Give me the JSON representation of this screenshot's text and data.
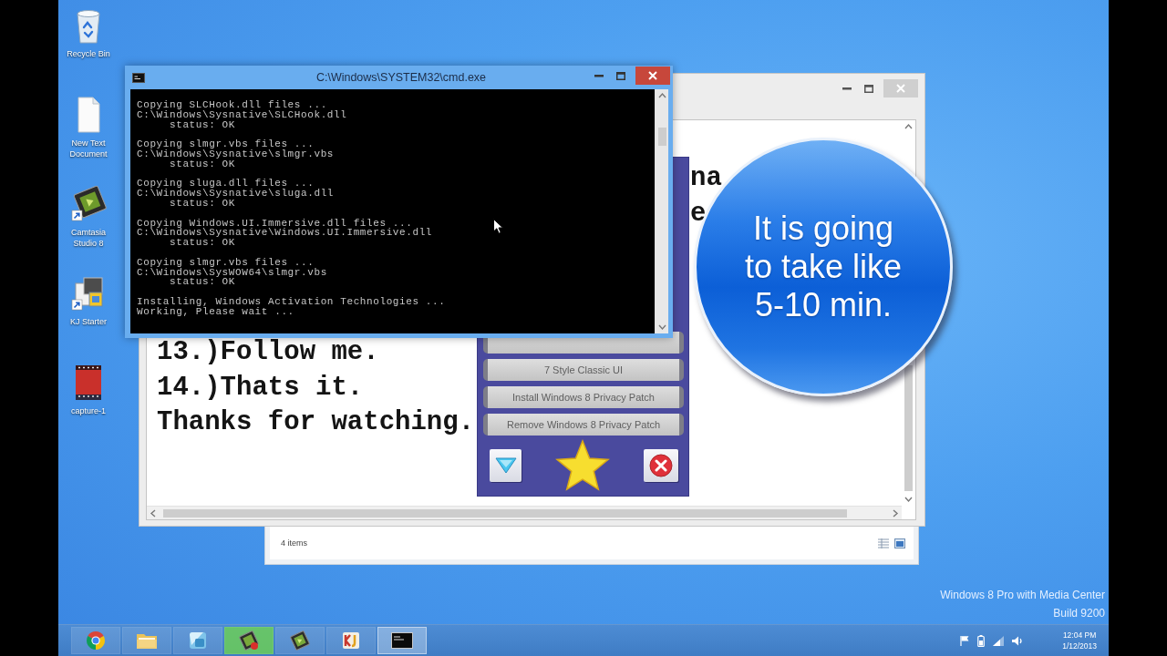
{
  "desktop": {
    "icons": [
      {
        "kind": "recycle-bin",
        "label": "Recycle Bin",
        "shortcut": false
      },
      {
        "kind": "text-document",
        "label": "New Text Document",
        "shortcut": false
      },
      {
        "kind": "camtasia",
        "label": "Camtasia Studio 8",
        "shortcut": true
      },
      {
        "kind": "starter",
        "label": "KJ Starter",
        "shortcut": true
      },
      {
        "kind": "video",
        "label": "capture-1",
        "shortcut": false
      }
    ],
    "edition": "Windows 8 Pro with Media Center",
    "build": "Build 9200"
  },
  "explorer_window": {
    "status": "4 items"
  },
  "notepad_window": {
    "active": false,
    "covered_fragments": [
      "na",
      "e"
    ],
    "lines": [
      "13.)Follow me.",
      "14.)Thats it.",
      "Thanks for watching."
    ]
  },
  "tool_panel": {
    "buttons": [
      {
        "kind": "covered"
      },
      {
        "kind": "text",
        "label": "7 Style Classic UI"
      },
      {
        "kind": "text",
        "label": "Install Windows 8 Privacy Patch"
      },
      {
        "kind": "text",
        "label": "Remove Windows 8 Privacy Patch"
      }
    ]
  },
  "cmd_window": {
    "active": true,
    "title": "C:\\Windows\\SYSTEM32\\cmd.exe",
    "output": [
      [
        {
          "kind": "message",
          "text": "Copying SLCHook.dll files ..."
        },
        {
          "kind": "message",
          "text": "C:\\Windows\\Sysnative\\SLCHook.dll"
        },
        {
          "kind": "status",
          "text": "status: OK"
        }
      ],
      [
        {
          "kind": "message",
          "text": "Copying slmgr.vbs files ..."
        },
        {
          "kind": "message",
          "text": "C:\\Windows\\Sysnative\\slmgr.vbs"
        },
        {
          "kind": "status",
          "text": "status: OK"
        }
      ],
      [
        {
          "kind": "message",
          "text": "Copying sluga.dll files ..."
        },
        {
          "kind": "message",
          "text": "C:\\Windows\\Sysnative\\sluga.dll"
        },
        {
          "kind": "status",
          "text": "status: OK"
        }
      ],
      [
        {
          "kind": "message",
          "text": "Copying Windows.UI.Immersive.dll files ..."
        },
        {
          "kind": "message",
          "text": "C:\\Windows\\Sysnative\\Windows.UI.Immersive.dll"
        },
        {
          "kind": "status",
          "text": "status: OK"
        }
      ],
      [
        {
          "kind": "message",
          "text": "Copying slmgr.vbs files ..."
        },
        {
          "kind": "message",
          "text": "C:\\Windows\\SysWOW64\\slmgr.vbs"
        },
        {
          "kind": "status",
          "text": "status: OK"
        }
      ],
      [
        {
          "kind": "message",
          "text": "Installing, Windows Activation Technologies ..."
        },
        {
          "kind": "message",
          "text": "Working, Please wait ..."
        }
      ]
    ]
  },
  "callout": {
    "text": "It is going to take like 5-10 min."
  },
  "taskbar": {
    "items": [
      {
        "kind": "chrome",
        "selected": false,
        "hovered": false
      },
      {
        "kind": "folder",
        "selected": false,
        "hovered": false
      },
      {
        "kind": "cube",
        "selected": false,
        "hovered": false
      },
      {
        "kind": "tilted-tile",
        "selected": false,
        "hovered": true
      },
      {
        "kind": "camtasia",
        "selected": false,
        "hovered": false
      },
      {
        "kind": "app",
        "selected": false,
        "hovered": false
      },
      {
        "kind": "terminal",
        "selected": true,
        "hovered": false
      }
    ],
    "clock": {
      "time": "12:04 PM",
      "date": "1/12/2013"
    }
  }
}
